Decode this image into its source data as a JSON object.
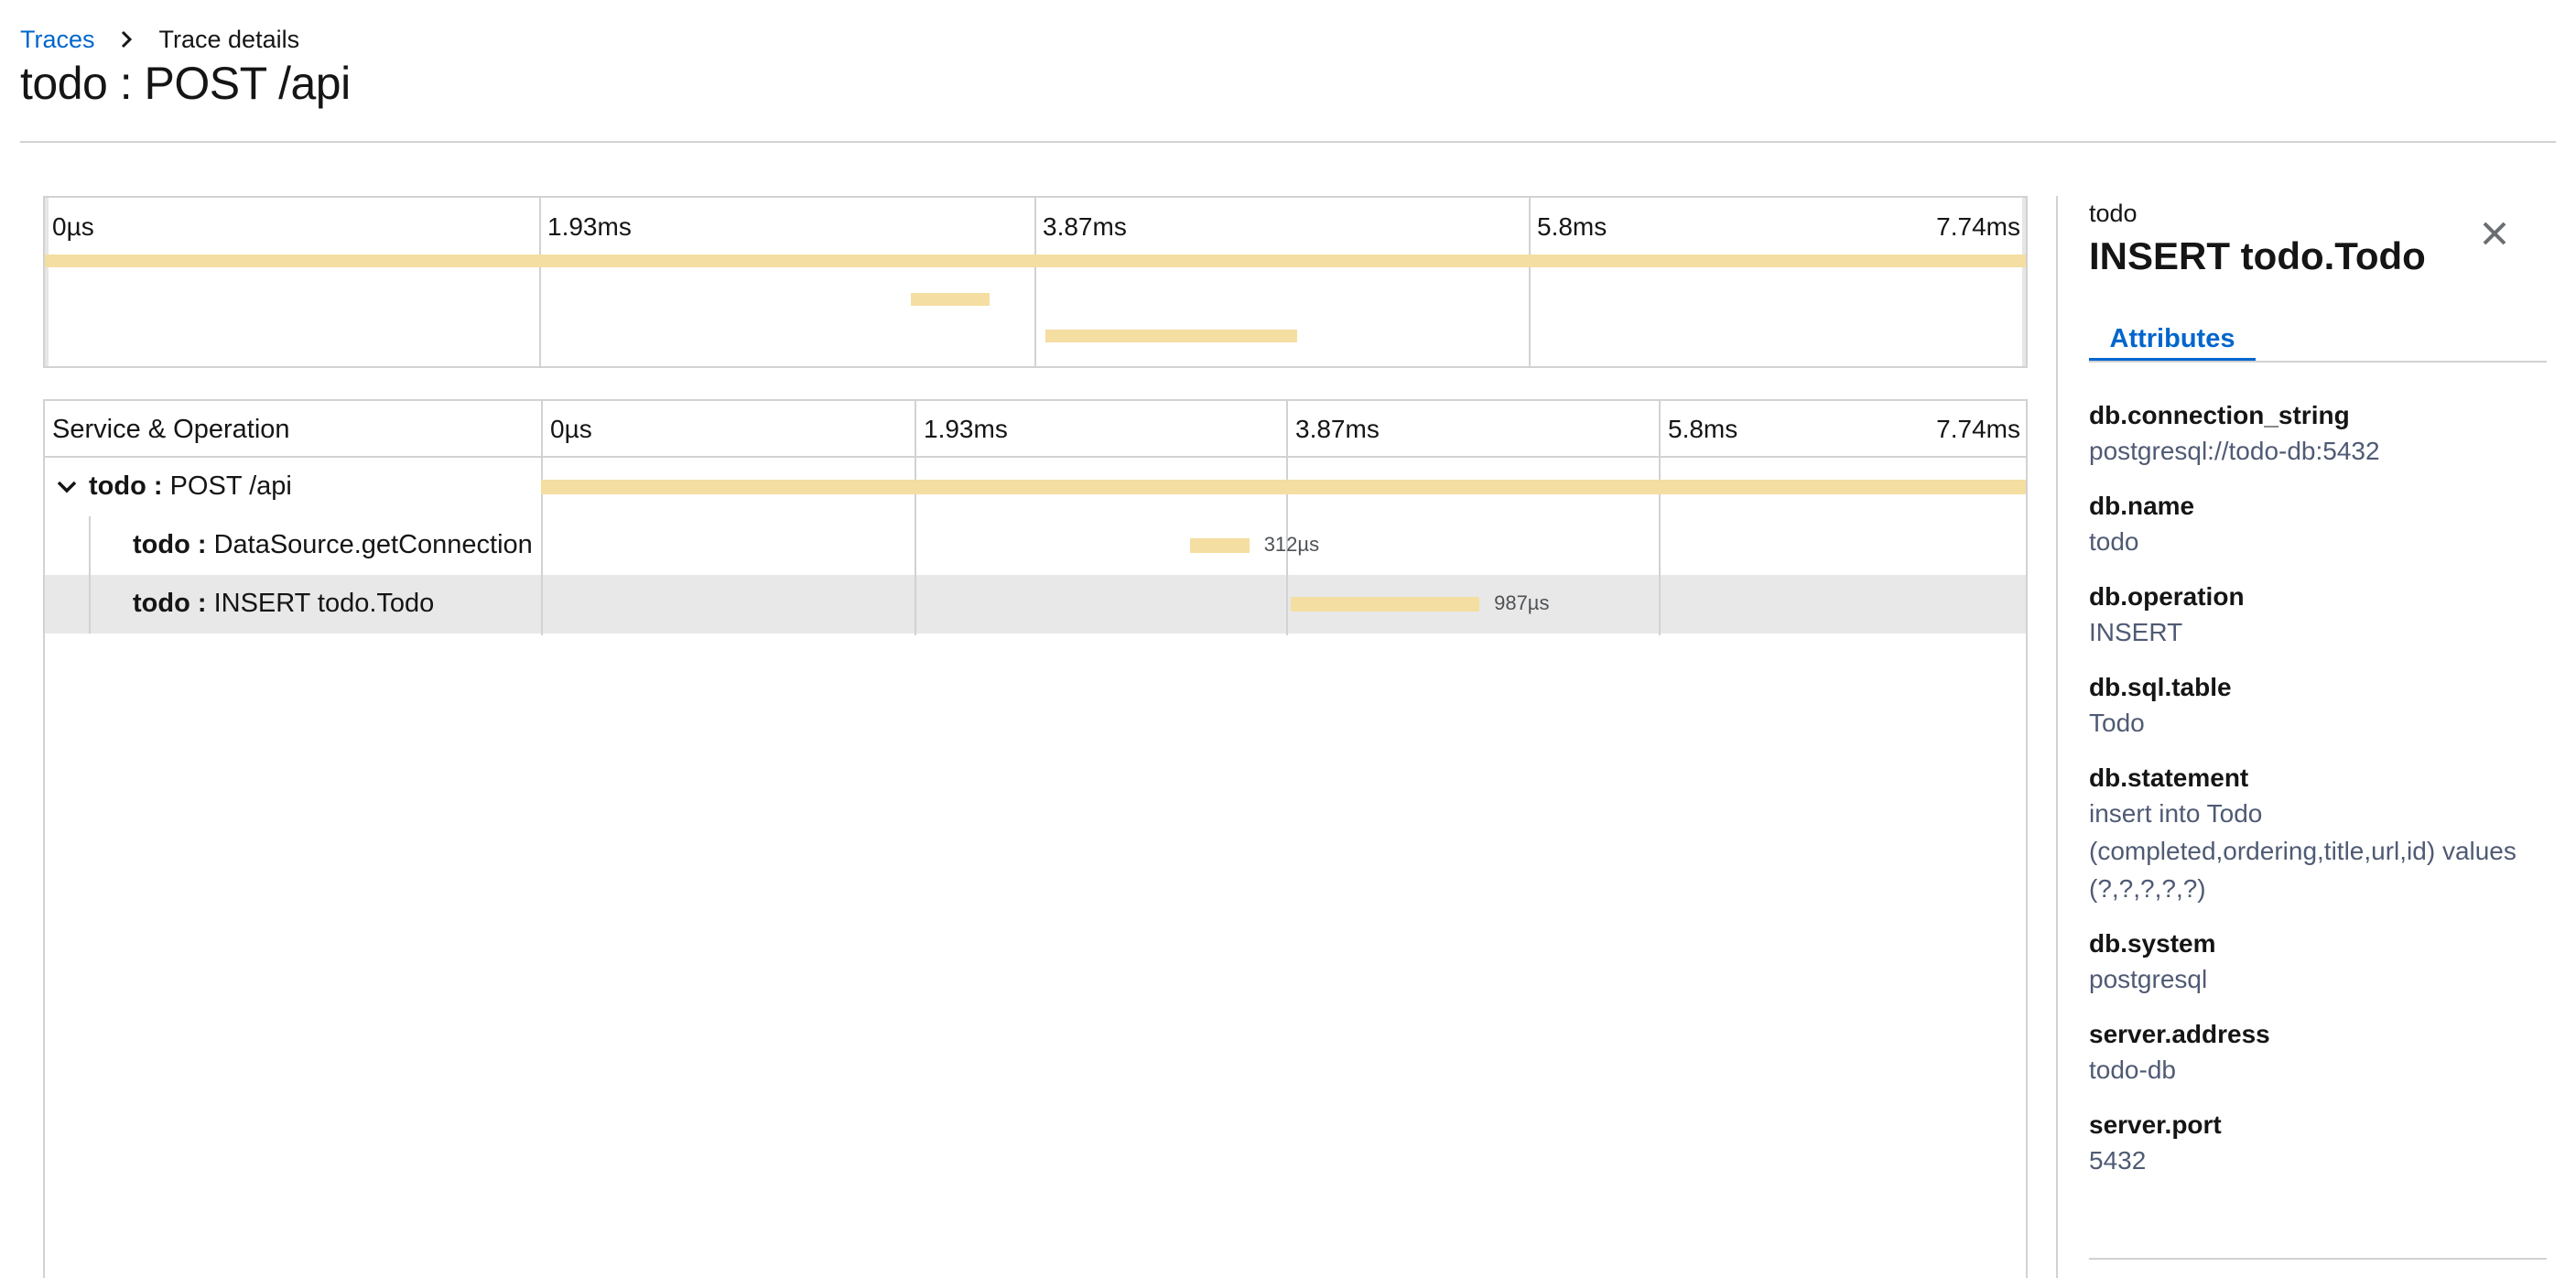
{
  "breadcrumb": {
    "link": "Traces",
    "current": "Trace details"
  },
  "page_title": "todo : POST /api",
  "overview": {
    "ticks": [
      "0µs",
      "1.93ms",
      "3.87ms",
      "5.8ms",
      "7.74ms"
    ]
  },
  "timeline": {
    "column_header": "Service & Operation",
    "ticks": [
      "0µs",
      "1.93ms",
      "3.87ms",
      "5.8ms",
      "7.74ms"
    ],
    "spans": [
      {
        "service": "todo :",
        "operation": "POST /api",
        "duration": "",
        "start_fraction": 0.0,
        "duration_fraction": 1.0,
        "expanded": true,
        "selected": false,
        "depth": 0
      },
      {
        "service": "todo :",
        "operation": "DataSource.getConnection",
        "duration": "312µs",
        "start_fraction": 0.437,
        "duration_fraction": 0.04,
        "selected": false,
        "depth": 1
      },
      {
        "service": "todo :",
        "operation": "INSERT todo.Todo",
        "duration": "987µs",
        "start_fraction": 0.505,
        "duration_fraction": 0.127,
        "selected": true,
        "depth": 1
      }
    ]
  },
  "details": {
    "service": "todo",
    "operation": "INSERT todo.Todo",
    "tab_label": "Attributes",
    "attributes": [
      {
        "key": "db.connection_string",
        "value": "postgresql://todo-db:5432"
      },
      {
        "key": "db.name",
        "value": "todo"
      },
      {
        "key": "db.operation",
        "value": "INSERT"
      },
      {
        "key": "db.sql.table",
        "value": "Todo"
      },
      {
        "key": "db.statement",
        "value": "insert into Todo (completed,ordering,title,url,id) values (?,?,?,?,?)"
      },
      {
        "key": "db.system",
        "value": "postgresql"
      },
      {
        "key": "server.address",
        "value": "todo-db"
      },
      {
        "key": "server.port",
        "value": "5432"
      }
    ]
  },
  "colors": {
    "link": "#0066cc",
    "span_bar": "#f4dea1",
    "selected_row": "#e8e8e8",
    "border": "#d2d2d2"
  },
  "icons": {
    "breadcrumb_separator": "chevron-right-icon",
    "row_toggle": "chevron-down-icon",
    "close": "close-icon"
  }
}
